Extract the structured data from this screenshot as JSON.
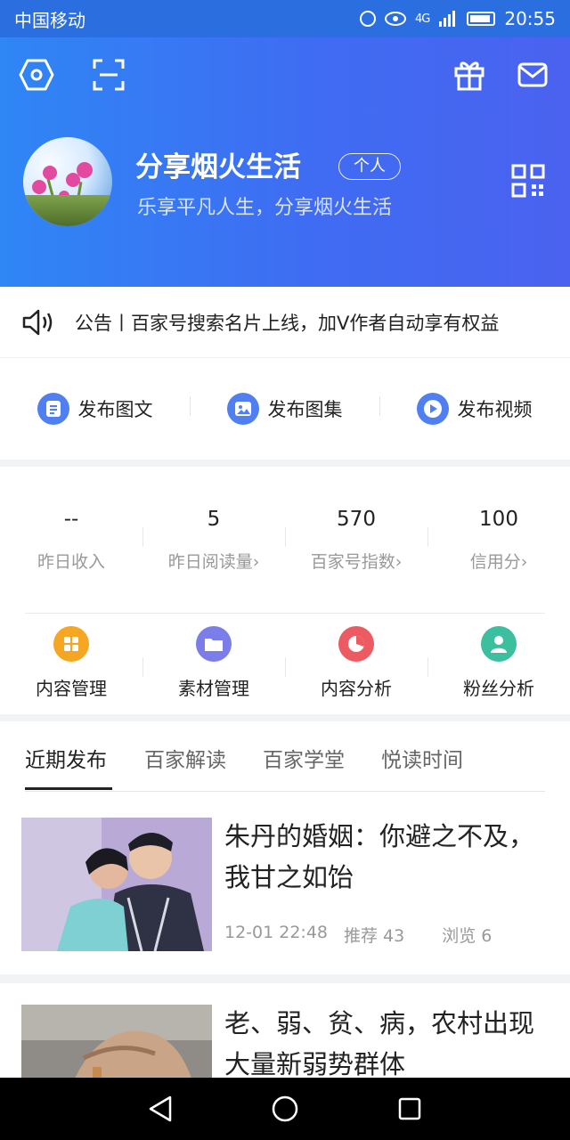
{
  "status_bar": {
    "carrier": "中国移动",
    "time": "20:55",
    "network": "4G"
  },
  "profile": {
    "name": "分享烟火生活",
    "tag": "个人",
    "motto": "乐享平凡人生，分享烟火生活"
  },
  "notice": {
    "text": "公告丨百家号搜索名片上线，加V作者自动享有权益"
  },
  "publish": [
    {
      "label": "发布图文",
      "icon": "doc-icon"
    },
    {
      "label": "发布图集",
      "icon": "image-icon"
    },
    {
      "label": "发布视频",
      "icon": "play-icon"
    }
  ],
  "stats": [
    {
      "value": "--",
      "label": "昨日收入"
    },
    {
      "value": "5",
      "label": "昨日阅读量"
    },
    {
      "value": "570",
      "label": "百家号指数"
    },
    {
      "value": "100",
      "label": "信用分"
    }
  ],
  "tools": [
    {
      "label": "内容管理",
      "color": "#f5a623",
      "icon": "grid-icon"
    },
    {
      "label": "素材管理",
      "color": "#7b7de8",
      "icon": "folder-icon"
    },
    {
      "label": "内容分析",
      "color": "#ec5b62",
      "icon": "pie-icon"
    },
    {
      "label": "粉丝分析",
      "color": "#3bbf9e",
      "icon": "user-icon"
    }
  ],
  "tabs": [
    "近期发布",
    "百家解读",
    "百家学堂",
    "悦读时间"
  ],
  "articles": [
    {
      "title": "朱丹的婚姻：你避之不及，我甘之如饴",
      "date": "12-01 22:48",
      "recommend": "推荐 43",
      "views": "浏览 6"
    },
    {
      "title": "老、弱、贫、病，农村出现大量新弱势群体"
    }
  ],
  "colors": {
    "brand": "#3f6cf2",
    "accent_text": "#222222",
    "muted": "#999999"
  }
}
